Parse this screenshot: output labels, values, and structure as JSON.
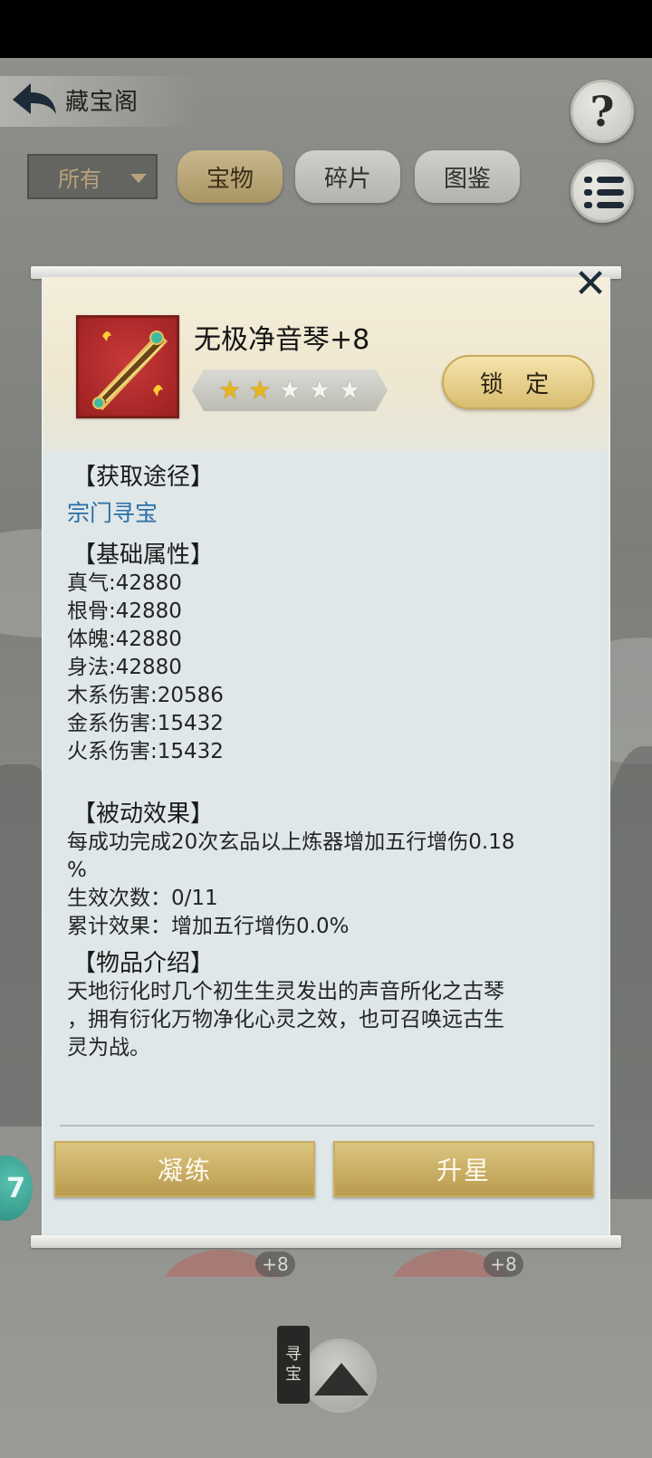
{
  "header": {
    "title": "藏宝阁",
    "help_label": "?"
  },
  "filter": {
    "selected": "所有"
  },
  "tabs": [
    {
      "label": "宝物",
      "active": true
    },
    {
      "label": "碎片",
      "active": false
    },
    {
      "label": "图鉴",
      "active": false
    }
  ],
  "item": {
    "name": "无极净音琴+8",
    "stars_total": 5,
    "stars_filled": 2,
    "lock_label": "锁 定"
  },
  "sections": {
    "source_title": "【获取途径】",
    "source_link": "宗门寻宝",
    "base_title": "【基础属性】",
    "base_stats": [
      "真气:42880",
      "根骨:42880",
      "体魄:42880",
      "身法:42880",
      "木系伤害:20586",
      "金系伤害:15432",
      "火系伤害:15432"
    ],
    "passive_title": "【被动效果】",
    "passive_lines": [
      "每成功完成20次玄品以上炼器增加五行增伤0.18",
      "%",
      "生效次数：0/11",
      "累计效果：增加五行增伤0.0%"
    ],
    "intro_title": "【物品介绍】",
    "intro_lines": [
      "天地衍化时几个初生生灵发出的声音所化之古琴",
      "，拥有衍化万物净化心灵之效，也可召唤远古生",
      "灵为战。"
    ]
  },
  "actions": {
    "refine_label": "凝练",
    "star_up_label": "升星"
  },
  "background": {
    "left_badge": "+8",
    "right_badge": "+8",
    "side_badge": "7",
    "treasure_label": [
      "寻",
      "宝"
    ]
  },
  "colors": {
    "link": "#2a6fa6",
    "star_on": "#e8b422",
    "button_gold": "#c9ad62"
  }
}
